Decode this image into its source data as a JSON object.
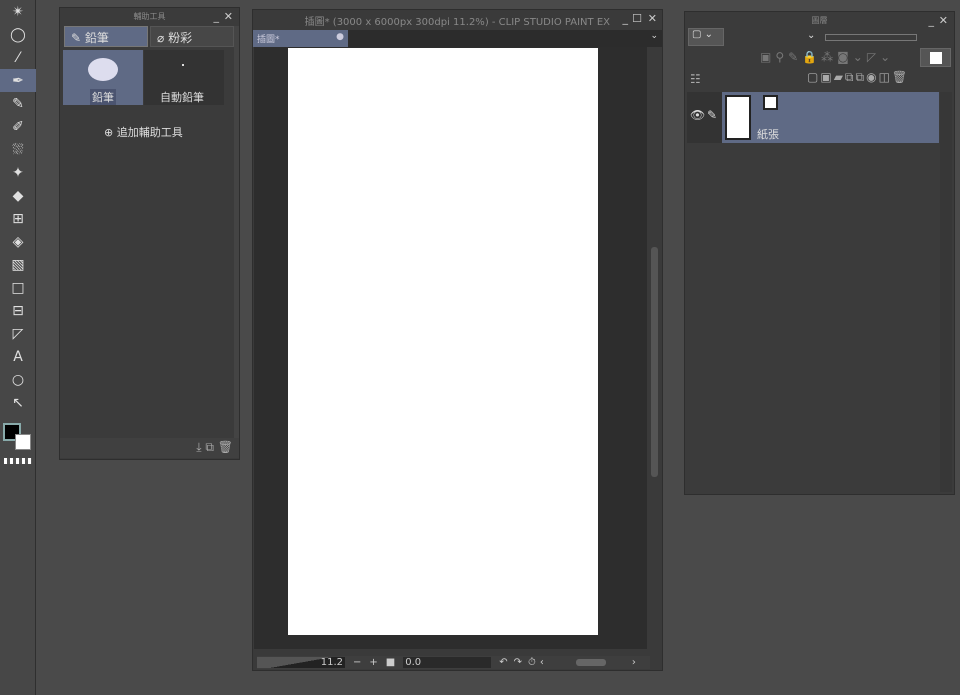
{
  "toolbar": {
    "tools": [
      "magic-wand",
      "lasso",
      "eyedropper",
      "pen",
      "pencil",
      "brush",
      "airbrush",
      "decoration",
      "eraser",
      "blend",
      "fill",
      "gradient",
      "figure",
      "frame",
      "ruler",
      "text",
      "balloon",
      "operation"
    ]
  },
  "subtool": {
    "title": "輔助工具",
    "tabs": [
      "鉛筆",
      "粉彩"
    ],
    "items": [
      "鉛筆",
      "自動鉛筆"
    ],
    "add_label": "追加輔助工具"
  },
  "canvas": {
    "title": "插圖* (3000 x 6000px 300dpi 11.2%)  - CLIP STUDIO PAINT EX",
    "tab": "插圖*",
    "zoom": "11.2",
    "rotation": "0.0"
  },
  "layer": {
    "title": "圖層",
    "layers": [
      {
        "name": "紙張"
      }
    ]
  },
  "colors": {
    "accent": "#5f6a85",
    "canvas": "#ffffff"
  }
}
